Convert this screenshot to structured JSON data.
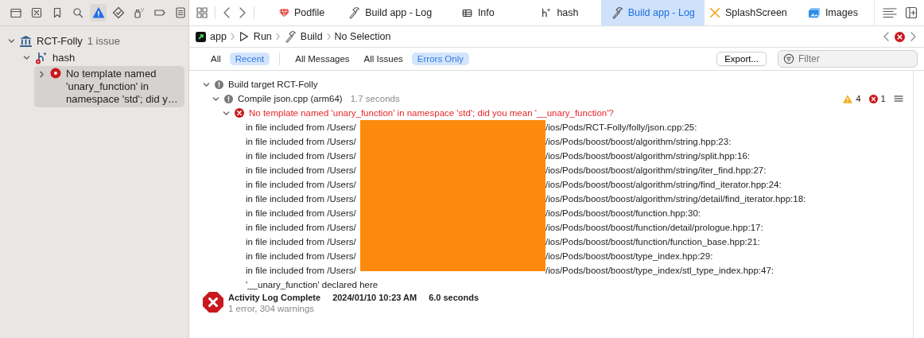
{
  "navigator_tabs": [
    {
      "selected": false
    },
    {
      "selected": false
    },
    {
      "selected": false
    },
    {
      "selected": false
    },
    {
      "selected": true
    },
    {
      "selected": false
    },
    {
      "selected": false
    },
    {
      "selected": false
    },
    {
      "selected": false
    }
  ],
  "issues": [
    {
      "label": "RCT-Folly",
      "count": "1 issue",
      "expanded": true,
      "children": [
        {
          "label": "hash",
          "expanded": true,
          "children": [
            {
              "label": "No template named 'unary_function' in namespace 'std'; did y…",
              "expanded": false,
              "selected": true
            }
          ]
        }
      ]
    }
  ],
  "editor_tabs": [
    {
      "label": "Podfile",
      "selected": false
    },
    {
      "label": "Build app - Log",
      "selected": false
    },
    {
      "label": "Info",
      "selected": false
    },
    {
      "label": "hash",
      "selected": false
    },
    {
      "label": "Build app - Log",
      "selected": true
    },
    {
      "label": "SplashScreen",
      "selected": false
    },
    {
      "label": "Images",
      "selected": false
    }
  ],
  "breadcrumb": [
    "app",
    "Run",
    "Build",
    "No Selection"
  ],
  "scope_filters": [
    {
      "label": "All",
      "selected": false
    },
    {
      "label": "Recent",
      "selected": true
    }
  ],
  "type_filters": [
    {
      "label": "All Messages",
      "selected": false
    },
    {
      "label": "All Issues",
      "selected": false
    },
    {
      "label": "Errors Only",
      "selected": true
    }
  ],
  "export_button": "Export...",
  "filter": {
    "placeholder": "Filter"
  },
  "log": {
    "target": "Build target RCT-Folly",
    "target_expanded": true,
    "compile": {
      "title": "Compile json.cpp (arm64)",
      "duration": "1.7 seconds",
      "warnings": "4",
      "errors": "1",
      "expanded": true
    },
    "error": {
      "message": "No template named 'unary_function' in namespace 'std'; did you mean '__unary_function'?",
      "expanded": true
    },
    "includes": [
      {
        "prefix": "in file included from /Users/",
        "path": "/ios/Pods/RCT-Folly/folly/json.cpp:25:"
      },
      {
        "prefix": "in file included from /Users/",
        "path": "/ios/Pods/boost/boost/algorithm/string.hpp:23:"
      },
      {
        "prefix": "in file included from /Users/",
        "path": "/ios/Pods/boost/boost/algorithm/string/split.hpp:16:"
      },
      {
        "prefix": "in file included from /Users/",
        "path": "/ios/Pods/boost/boost/algorithm/string/iter_find.hpp:27:"
      },
      {
        "prefix": "in file included from /Users/",
        "path": "/ios/Pods/boost/boost/algorithm/string/find_iterator.hpp:24:"
      },
      {
        "prefix": "in file included from /Users/",
        "path": "/ios/Pods/boost/boost/algorithm/string/detail/find_iterator.hpp:18:"
      },
      {
        "prefix": "in file included from /Users/",
        "path": "/ios/Pods/boost/boost/function.hpp:30:"
      },
      {
        "prefix": "in file included from /Users/",
        "path": "/ios/Pods/boost/boost/function/detail/prologue.hpp:17:"
      },
      {
        "prefix": "in file included from /Users/",
        "path": "/ios/Pods/boost/boost/function/function_base.hpp:21:"
      },
      {
        "prefix": "in file included from /Users/",
        "path": "/ios/Pods/boost/boost/type_index.hpp:29:"
      },
      {
        "prefix": "in file included from /Users/",
        "path": "/ios/Pods/boost/boost/type_index/stl_type_index.hpp:47:"
      }
    ],
    "note": "'__unary_function' declared here",
    "summary": {
      "title": "Activity Log Complete",
      "date": "2024/01/10 10:23 AM",
      "duration": "6.0 seconds",
      "detail": "1 error, 304 warnings"
    }
  }
}
